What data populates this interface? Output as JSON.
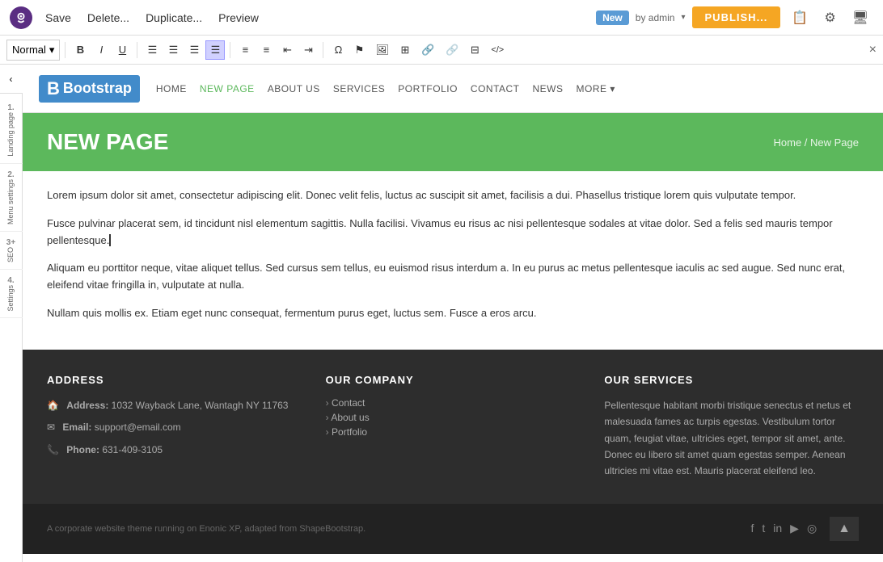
{
  "topbar": {
    "save_label": "Save",
    "delete_label": "Delete...",
    "duplicate_label": "Duplicate...",
    "preview_label": "Preview",
    "status_new": "New",
    "by_admin": "by admin",
    "publish_label": "PUBLISH...",
    "icons": {
      "clipboard": "📋",
      "gear": "⚙",
      "monitor": "🖥"
    }
  },
  "toolbar": {
    "format_selected": "Normal",
    "format_arrow": "▾",
    "bold": "B",
    "italic": "I",
    "underline": "U",
    "align_left": "≡",
    "align_center": "≡",
    "align_right": "≡",
    "align_justify": "≡",
    "list_bullet": "≡",
    "list_ordered": "≡",
    "indent_less": "⇤",
    "indent_more": "⇥",
    "omega": "Ω",
    "flag": "⚑",
    "image": "🖼",
    "table_icon": "⊞",
    "link": "🔗",
    "unlink": "🔗",
    "table2": "⊟",
    "code": "</>",
    "close": "×"
  },
  "sidebar": {
    "toggle": "‹",
    "items": [
      {
        "number": "1.",
        "label": "Landing page"
      },
      {
        "number": "2.",
        "label": "Menu settings"
      },
      {
        "number": "3+",
        "label": "SEO"
      },
      {
        "number": "4.",
        "label": "Settings"
      }
    ]
  },
  "nav": {
    "logo_icon": "B",
    "logo_text": "Bootstrap",
    "links": [
      {
        "label": "HOME",
        "active": false
      },
      {
        "label": "NEW PAGE",
        "active": true
      },
      {
        "label": "ABOUT US",
        "active": false
      },
      {
        "label": "SERVICES",
        "active": false
      },
      {
        "label": "PORTFOLIO",
        "active": false
      },
      {
        "label": "CONTACT",
        "active": false
      },
      {
        "label": "NEWS",
        "active": false
      },
      {
        "label": "MORE",
        "active": false
      }
    ]
  },
  "hero": {
    "title": "New Page",
    "breadcrumb": "Home / New Page"
  },
  "content": {
    "paragraphs": [
      "Lorem ipsum dolor sit amet, consectetur adipiscing elit. Donec velit felis, luctus ac suscipit sit amet, facilisis a dui. Phasellus tristique lorem quis vulputate tempor.",
      "Fusce pulvinar placerat sem, id tincidunt nisl elementum sagittis. Nulla facilisi. Vivamus eu risus ac nisi pellentesque sodales at vitae dolor. Sed a felis sed mauris tempor pellentesque.",
      "Aliquam eu porttitor neque, vitae aliquet tellus. Sed cursus sem tellus, eu euismod risus interdum a. In eu purus ac metus pellentesque iaculis ac sed augue. Sed nunc erat, eleifend vitae fringilla in, vulputate at nulla.",
      "Nullam quis mollis ex. Etiam eget nunc consequat, fermentum purus eget, luctus sem. Fusce a eros arcu."
    ]
  },
  "footer": {
    "col1": {
      "title": "ADDRESS",
      "address_label": "Address:",
      "address_value": "1032 Wayback Lane, Wantagh NY 11763",
      "email_label": "Email:",
      "email_value": "support@email.com",
      "phone_label": "Phone:",
      "phone_value": "631-409-3105"
    },
    "col2": {
      "title": "OUR COMPANY",
      "links": [
        "Contact",
        "About us",
        "Portfolio"
      ]
    },
    "col3": {
      "title": "OUR SERVICES",
      "text": "Pellentesque habitant morbi tristique senectus et netus et malesuada fames ac turpis egestas. Vestibulum tortor quam, feugiat vitae, ultricies eget, tempor sit amet, ante. Donec eu libero sit amet quam egestas semper. Aenean ultricies mi vitae est. Mauris placerat eleifend leo."
    }
  },
  "footer_bottom": {
    "text": "A corporate website theme running on Enonic XP, adapted from ShapeBootstrap.",
    "social_icons": [
      "f",
      "t",
      "in",
      "yt",
      "ig"
    ],
    "back_to_top": "▲"
  }
}
